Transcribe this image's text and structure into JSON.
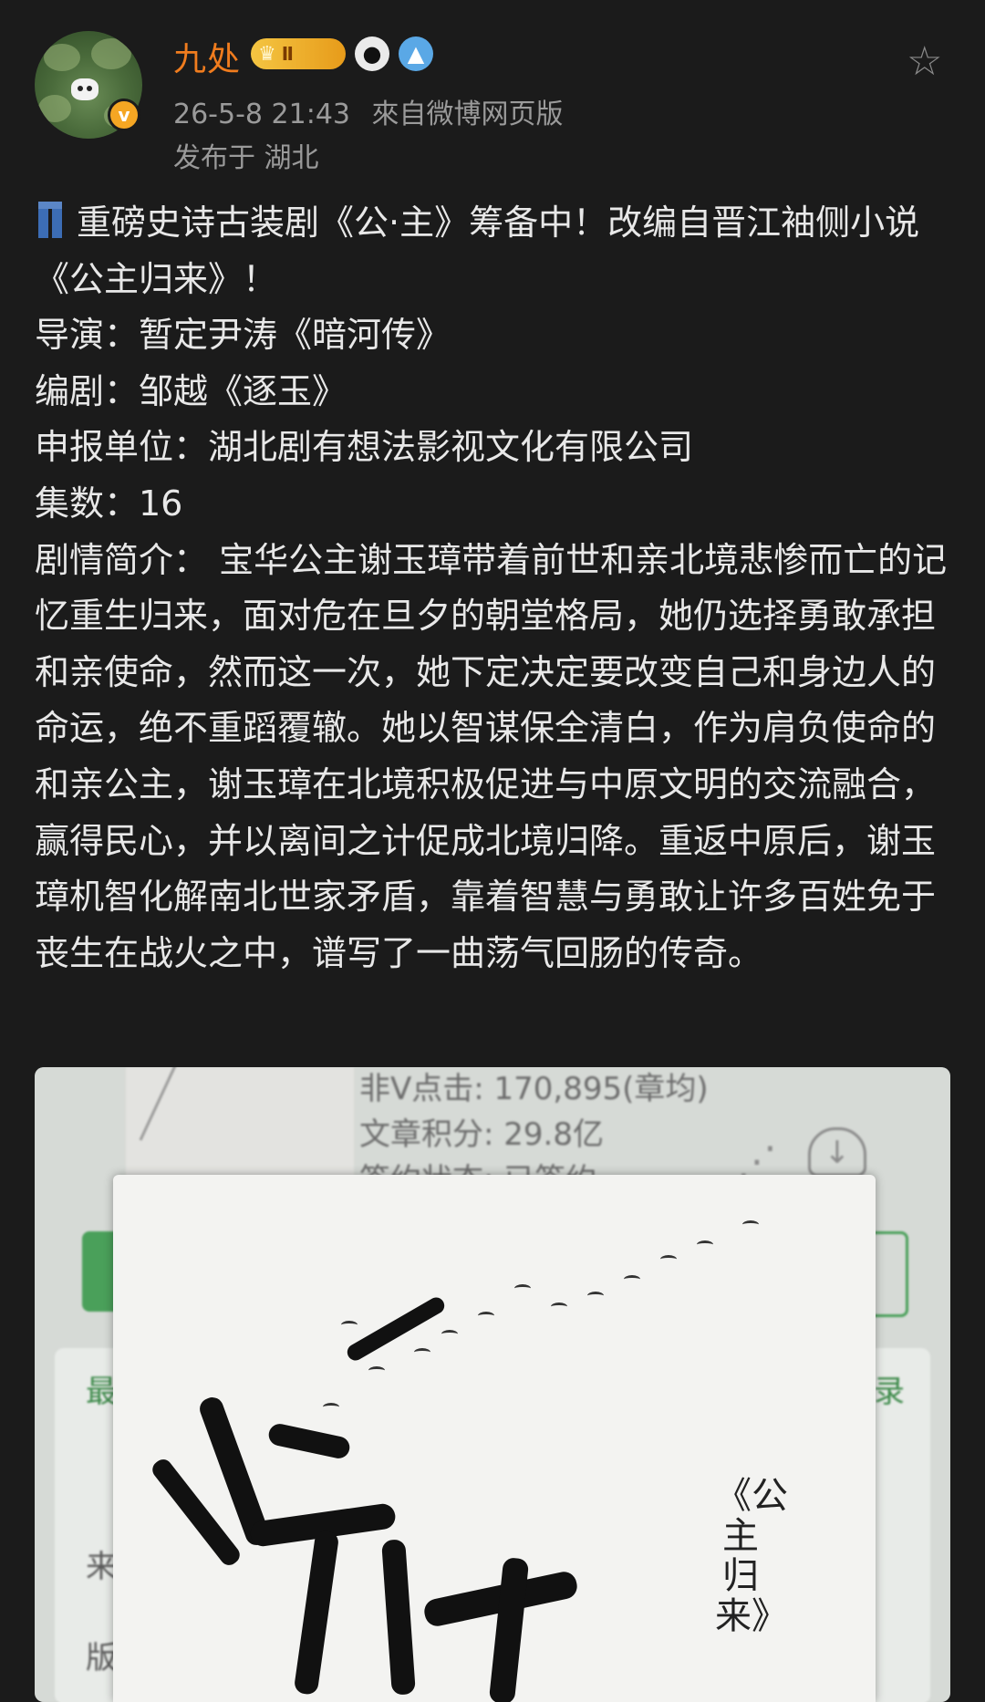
{
  "header": {
    "username": "九处",
    "level_badge": "Ⅱ",
    "timestamp": "26-5-8 21:43",
    "source": "來自微博网页版",
    "location": "发布于 湖北",
    "verified_mark": "v",
    "star_icon": "☆"
  },
  "post": {
    "line1": "重磅史诗古装剧《公·主》筹备中！改编自晋江袖侧小说《公主归来》！",
    "director": "导演：暂定尹涛《暗河传》",
    "writer": "编剧：邹越《逐玉》",
    "company": "申报单位：湖北剧有想法影视文化有限公司",
    "episodes": "集数：16",
    "synopsis": "剧情简介：  宝华公主谢玉璋带着前世和亲北境悲惨而亡的记忆重生归来，面对危在旦夕的朝堂格局，她仍选择勇敢承担和亲使命，然而这一次，她下定决定要改变自己和身边人的命运，绝不重蹈覆辙。她以智谋保全清白，作为肩负使命的和亲公主，谢玉璋在北境积极促进与中原文明的交流融合，赢得民心，并以离间之计促成北境归降。重返中原后，谢玉璋机智化解南北世家矛盾，靠着智慧与勇敢让许多百姓免于丧生在战火之中，谱写了一曲荡气回肠的传奇。"
  },
  "image": {
    "bg_line1": "非V点击: 170,895(章均)",
    "bg_line2": "文章积分: 29.8亿",
    "bg_line3": "签约状态: 已签约",
    "bg_left1": "最",
    "bg_right1": "录",
    "bg_left2": "来",
    "bg_left3": "版",
    "cover_title": "《公主归来》"
  }
}
